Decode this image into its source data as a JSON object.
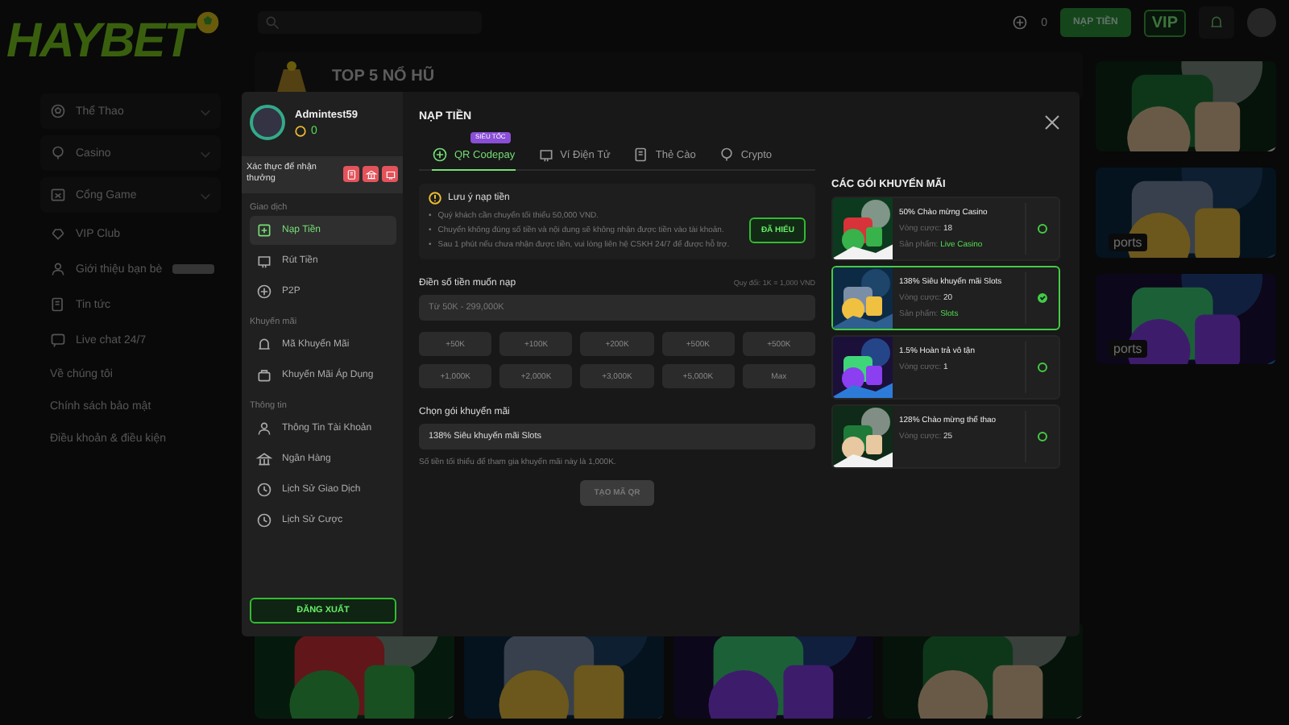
{
  "logo": {
    "text": "HAYBET"
  },
  "nav": [
    {
      "kind": "group",
      "label": "Thể Thao",
      "expanded": false
    },
    {
      "kind": "group",
      "label": "Casino",
      "expanded": false
    },
    {
      "kind": "group",
      "label": "Cổng Game",
      "expanded": false
    },
    {
      "kind": "item",
      "label": "VIP Club"
    },
    {
      "kind": "item",
      "label": "Giới thiệu bạn bè"
    },
    {
      "kind": "item",
      "label": "Tin tức"
    },
    {
      "kind": "item",
      "label": "Live chat 24/7"
    },
    {
      "kind": "link",
      "label": "Về chúng tôi"
    },
    {
      "kind": "link",
      "label": "Chính sách bảo mật"
    },
    {
      "kind": "link",
      "label": "Điều khoản & điều kiện"
    }
  ],
  "header": {
    "balance": "0",
    "deposit_button": "NẠP TIỀN",
    "vip_button": "VIP"
  },
  "jackpot": {
    "title": "TOP 5 NỔ HŨ"
  },
  "side_banners": [
    {
      "caption": "ports"
    },
    {
      "caption": "ports"
    }
  ],
  "modal": {
    "user": {
      "name": "Admintest59",
      "balance": "0"
    },
    "verify": {
      "label": "Xác thực để nhận thưởng"
    },
    "menu": [
      {
        "heading": "Giao dịch",
        "items": [
          {
            "label": "Nạp Tiền",
            "selected": true
          },
          {
            "label": "Rút Tiền",
            "selected": false
          },
          {
            "label": "P2P",
            "selected": false
          }
        ]
      },
      {
        "heading": "Khuyến mãi",
        "items": [
          {
            "label": "Mã Khuyến Mãi",
            "selected": false
          },
          {
            "label": "Khuyến Mãi Áp Dụng",
            "selected": false
          }
        ]
      },
      {
        "heading": "Thông tin",
        "items": [
          {
            "label": "Thông Tin Tài Khoản",
            "selected": false
          },
          {
            "label": "Ngân Hàng",
            "selected": false
          },
          {
            "label": "Lịch Sử Giao Dịch",
            "selected": false
          },
          {
            "label": "Lịch Sử Cược",
            "selected": false
          }
        ]
      }
    ],
    "logout": "ĐĂNG XUẤT",
    "title": "NẠP TIỀN",
    "tabs": [
      {
        "label": "QR Codepay",
        "badge": "SIÊU TỐC",
        "selected": true
      },
      {
        "label": "Ví Điện Tử",
        "selected": false
      },
      {
        "label": "Thẻ Cào",
        "selected": false
      },
      {
        "label": "Crypto",
        "selected": false
      }
    ],
    "notice": {
      "title": "Lưu ý nạp tiền",
      "marker": "•",
      "lines": [
        "Quý khách cần chuyển tối thiểu 50,000 VND.",
        "Chuyển không đúng số tiền và nội dung sẽ không nhận được tiền vào tài khoản.",
        "Sau 1 phút nếu chưa nhận được tiền, vui lòng liên hệ CSKH 24/7 để được hỗ trợ."
      ],
      "button": "ĐÃ HIỂU"
    },
    "amount": {
      "label": "Điền số tiền muốn nạp",
      "rate": "Quy đổi: 1K = 1,000 VND",
      "placeholder": "Từ 50K - 299,000K",
      "presets": [
        "+50K",
        "+100K",
        "+200K",
        "+500K",
        "+500K",
        "+1,000K",
        "+2,000K",
        "+3,000K",
        "+5,000K",
        "Max"
      ]
    },
    "promo_select": {
      "label": "Chọn gói khuyến mãi",
      "value": "138% Siêu khuyến mãi Slots",
      "note": "Số tiền tối thiểu để tham gia khuyến mãi này là 1,000K."
    },
    "submit": {
      "label": "TẠO MÃ QR",
      "disabled": true
    },
    "promotions": {
      "title": "CÁC GÓI KHUYẾN MÃI",
      "items": [
        {
          "title": "50% Chào mừng Casino",
          "wager_label": "Vòng cược:",
          "wager": "18",
          "product_label": "Sản phẩm:",
          "product": "Live Casino",
          "selected": false
        },
        {
          "title": "138% Siêu khuyến mãi Slots",
          "wager_label": "Vòng cược:",
          "wager": "20",
          "product_label": "Sản phẩm:",
          "product": "Slots",
          "selected": true
        },
        {
          "title": "1.5% Hoàn trả vô tận",
          "wager_label": "Vòng cược:",
          "wager": "1",
          "selected": false
        },
        {
          "title": "128% Chào mừng thể thao",
          "wager_label": "Vòng cược:",
          "wager": "25",
          "selected": false
        }
      ]
    }
  }
}
